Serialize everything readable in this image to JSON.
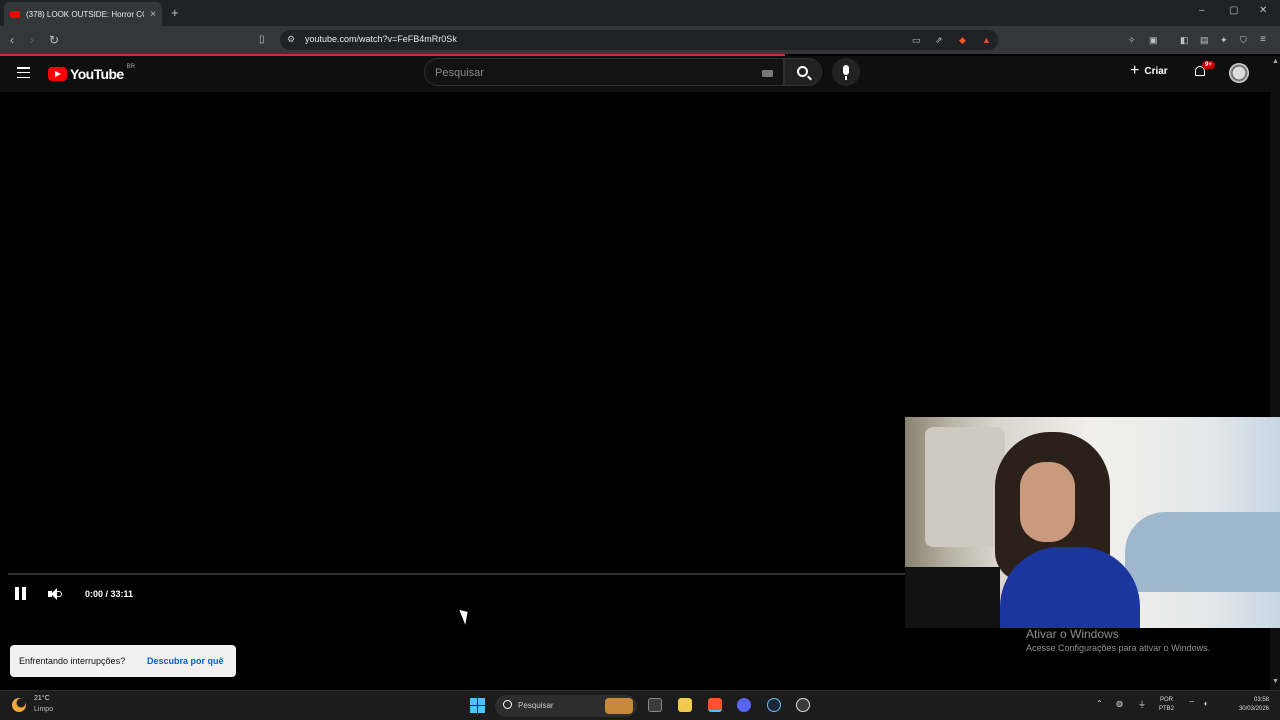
{
  "browser": {
    "tab_title": "(378) LOOK OUTSIDE: Horror CO",
    "tab_close": "×",
    "new_tab": "+",
    "url": "youtube.com/watch?v=FeFB4mRr0Sk",
    "window_controls": {
      "minimize": "–",
      "maximize": "▢",
      "close": "✕"
    }
  },
  "youtube": {
    "logo_text": "YouTube",
    "country_code": "BR",
    "search_placeholder": "Pesquisar",
    "create_label": "Criar",
    "create_plus": "+",
    "notification_badge": "9+"
  },
  "player": {
    "current_time": "0:00",
    "duration": "33:11",
    "time_display": "0:00 / 33:11",
    "progress_fraction": 0.0
  },
  "toast": {
    "message": "Enfrentando interrupções?",
    "link": "Descubra por quê"
  },
  "watermark": {
    "title": "Ativar o Windows",
    "subtitle": "Acesse Configurações para ativar o Windows."
  },
  "taskbar": {
    "weather_temp": "21°C",
    "weather_cond": "Limpo",
    "search_placeholder": "Pesquisar",
    "lang_top": "POR",
    "lang_bottom": "PTB2",
    "time": "03:58",
    "date": "30/03/2026"
  },
  "colors": {
    "yt_red": "#ff0000",
    "link_blue": "#065fd4",
    "start_blue": "#4cc2ff"
  }
}
